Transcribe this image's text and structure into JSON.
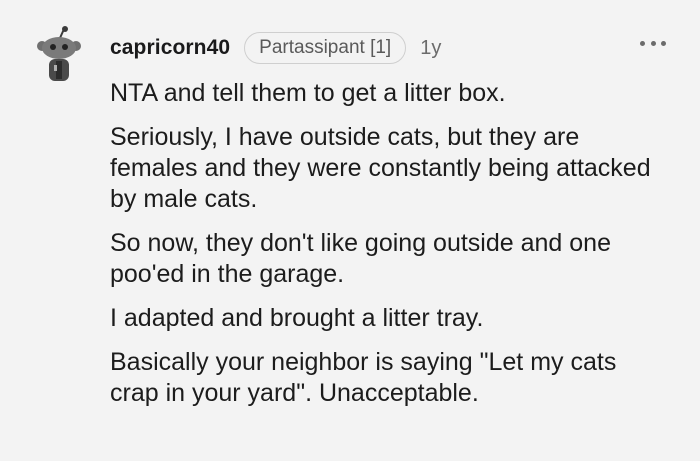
{
  "comment": {
    "author": "capricorn40",
    "flair": "Partassipant [1]",
    "age": "1y",
    "more_icon": "ellipsis-icon",
    "avatar_icon": "snoo-avatar-icon",
    "paragraphs": [
      "NTA and tell them to get a litter box.",
      "Seriously, I have outside cats, but they are females and they were constantly being attacked by male cats.",
      "So now, they don't like going outside and one poo'ed in the garage.",
      "I adapted and brought a litter tray.",
      "Basically your neighbor is saying \"Let my cats crap in your yard\". Unacceptable."
    ]
  }
}
